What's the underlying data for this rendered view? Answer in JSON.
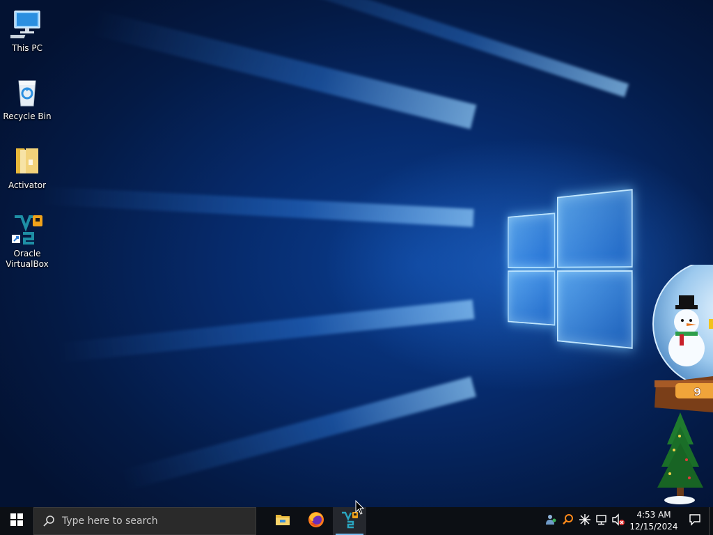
{
  "desktop": {
    "icons": [
      {
        "label": "This PC",
        "icon": "computer-icon"
      },
      {
        "label": "Recycle Bin",
        "icon": "recycle-bin-icon"
      },
      {
        "label": "Activator",
        "icon": "folder-icon"
      },
      {
        "label_line1": "Oracle",
        "label_line2": "VirtualBox",
        "icon": "virtualbox-icon"
      }
    ],
    "gadget": {
      "name": "snow-globe-gadget",
      "digit": "9"
    }
  },
  "taskbar": {
    "start_icon": "windows-logo-icon",
    "search_placeholder": "Type here to search",
    "pinned_apps": [
      {
        "name": "File Explorer",
        "icon": "file-explorer-icon"
      },
      {
        "name": "Firefox",
        "icon": "firefox-icon"
      },
      {
        "name": "Oracle VirtualBox",
        "icon": "virtualbox-icon",
        "active": true
      }
    ],
    "tray": {
      "icons": [
        "people-icon",
        "search-tool-icon",
        "sparkle-icon",
        "network-icon",
        "volume-muted-icon"
      ],
      "time": "4:53 AM",
      "date": "12/15/2024"
    },
    "accent_color": "#76b9ed"
  }
}
